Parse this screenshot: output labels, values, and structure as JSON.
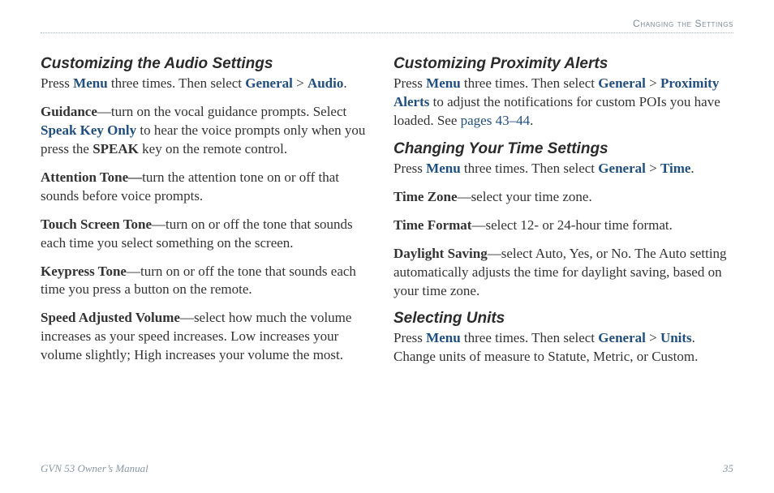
{
  "header": {
    "section_label": "Changing the Settings"
  },
  "audio": {
    "title": "Customizing the Audio Settings",
    "intro_pre": "Press ",
    "intro_menu": "Menu",
    "intro_mid": " three times. Then select ",
    "intro_general": "General",
    "intro_gt": " > ",
    "intro_sub": "Audio",
    "intro_end": ".",
    "guidance_label": "Guidance",
    "guidance_pre": "—turn on the vocal guidance prompts. Select ",
    "guidance_speak": "Speak Key Only",
    "guidance_mid": " to hear the voice prompts only when you press the ",
    "guidance_key": "SPEAK",
    "guidance_end": " key on the remote control.",
    "attention_label": "Attention Tone—",
    "attention_text": "turn the attention tone on or off that sounds before voice prompts.",
    "touch_label": "Touch Screen Tone",
    "touch_text": "—turn on or off the tone that sounds each time you select something on the screen.",
    "keypress_label": "Keypress Tone",
    "keypress_text": "—turn on or off the tone that sounds each time you press a button on the remote.",
    "speed_label": "Speed Adjusted Volume",
    "speed_text": "—select how much the volume increases as your speed increases. Low increases your volume slightly; High increases your volume the most."
  },
  "proximity": {
    "title": "Customizing Proximity Alerts",
    "intro_pre": "Press ",
    "intro_menu": "Menu",
    "intro_mid": " three times. Then select ",
    "intro_general": "General",
    "intro_gt": " > ",
    "intro_sub": "Proximity Alerts",
    "intro_after": " to adjust the notifications for custom POIs you have loaded. See ",
    "pages_link": "pages 43–44",
    "intro_end": "."
  },
  "time": {
    "title": "Changing Your Time Settings",
    "intro_pre": "Press ",
    "intro_menu": "Menu",
    "intro_mid": " three times. Then select ",
    "intro_general": "General",
    "intro_gt": " > ",
    "intro_sub": "Time",
    "intro_end": ".",
    "tz_label": "Time Zone",
    "tz_text": "—select your time zone.",
    "tf_label": "Time Format",
    "tf_text": "—select 12- or 24-hour time format.",
    "ds_label": "Daylight Saving",
    "ds_text": "—select Auto, Yes, or No. The Auto setting automatically adjusts the time for daylight saving, based on your time zone."
  },
  "units": {
    "title": "Selecting Units",
    "intro_pre": "Press ",
    "intro_menu": "Menu",
    "intro_mid": " three times. Then select ",
    "intro_general": "General",
    "intro_gt": " > ",
    "intro_sub": "Units",
    "intro_end": ". Change units of measure to Statute, Metric, or Custom."
  },
  "footer": {
    "left": "GVN 53 Owner’s Manual",
    "right": "35"
  }
}
